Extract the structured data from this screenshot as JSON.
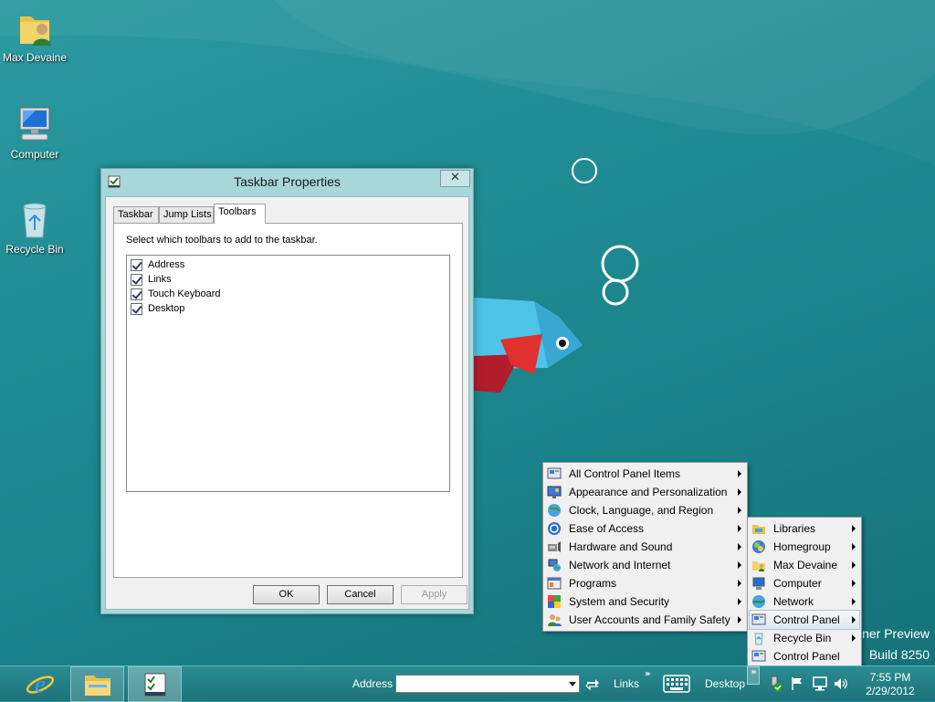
{
  "desktop": {
    "icons": [
      {
        "label": "Max Devaine",
        "icon": "user-folder-icon"
      },
      {
        "label": "Computer",
        "icon": "computer-icon"
      },
      {
        "label": "Recycle Bin",
        "icon": "recycle-bin-icon"
      }
    ],
    "watermark_line1": "ner Preview",
    "watermark_line2": "Build 8250"
  },
  "dialog": {
    "title": "Taskbar Properties",
    "close_symbol": "✕",
    "tabs": [
      {
        "label": "Taskbar",
        "active": false
      },
      {
        "label": "Jump Lists",
        "active": false
      },
      {
        "label": "Toolbars",
        "active": true
      }
    ],
    "instruction": "Select which toolbars to add to the taskbar.",
    "toolbars": [
      {
        "label": "Address",
        "checked": true
      },
      {
        "label": "Links",
        "checked": true
      },
      {
        "label": "Touch Keyboard",
        "checked": true
      },
      {
        "label": "Desktop",
        "checked": true
      }
    ],
    "buttons": {
      "ok": "OK",
      "cancel": "Cancel",
      "apply": "Apply"
    }
  },
  "control_panel_menu": {
    "items": [
      {
        "label": "All Control Panel Items",
        "icon": "control-panel-icon"
      },
      {
        "label": "Appearance and Personalization",
        "icon": "appearance-icon"
      },
      {
        "label": "Clock, Language, and Region",
        "icon": "clock-globe-icon"
      },
      {
        "label": "Ease of Access",
        "icon": "ease-of-access-icon"
      },
      {
        "label": "Hardware and Sound",
        "icon": "hardware-sound-icon"
      },
      {
        "label": "Network and Internet",
        "icon": "network-internet-icon"
      },
      {
        "label": "Programs",
        "icon": "programs-icon"
      },
      {
        "label": "System and Security",
        "icon": "system-security-icon"
      },
      {
        "label": "User Accounts and Family Safety",
        "icon": "user-accounts-icon"
      }
    ]
  },
  "desktop_menu": {
    "items": [
      {
        "label": "Libraries",
        "icon": "libraries-icon",
        "submenu": true
      },
      {
        "label": "Homegroup",
        "icon": "homegroup-icon",
        "submenu": true
      },
      {
        "label": "Max Devaine",
        "icon": "user-folder-icon",
        "submenu": true
      },
      {
        "label": "Computer",
        "icon": "computer-icon",
        "submenu": true
      },
      {
        "label": "Network",
        "icon": "network-icon",
        "submenu": true
      },
      {
        "label": "Control Panel",
        "icon": "control-panel-icon",
        "submenu": true,
        "hover": true
      },
      {
        "label": "Recycle Bin",
        "icon": "recycle-bin-icon",
        "submenu": true
      },
      {
        "label": "Control Panel",
        "icon": "control-panel-icon",
        "submenu": false
      }
    ]
  },
  "taskbar": {
    "address_label": "Address",
    "address_value": "",
    "links_label": "Links",
    "desktop_label": "Desktop",
    "chevron": "»",
    "time": "7:55 PM",
    "date": "2/29/2012"
  },
  "colors": {
    "desktop": "#1f8c93",
    "taskbar": "#24818a",
    "menu": "#f0f0f0"
  }
}
